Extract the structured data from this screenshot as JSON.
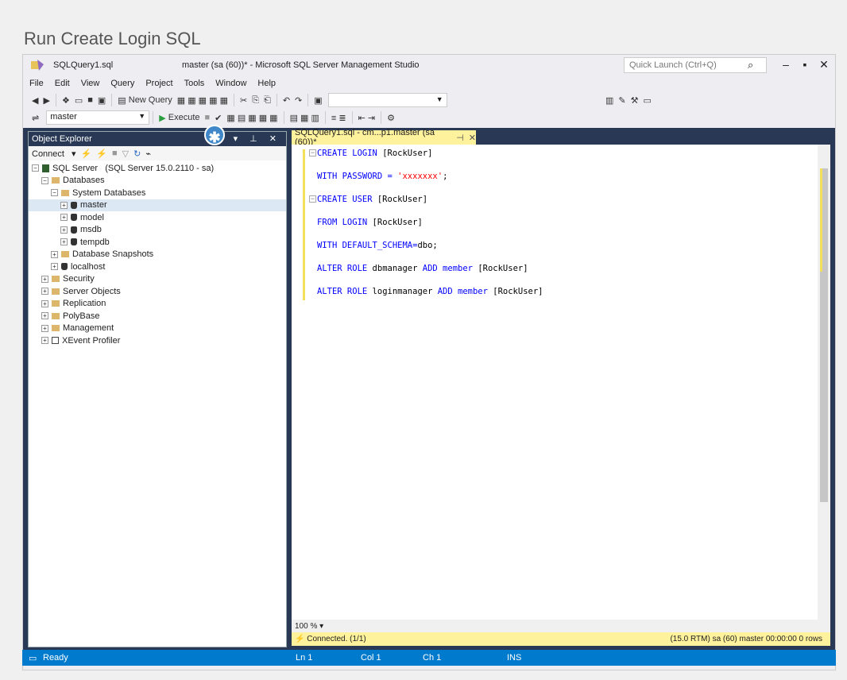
{
  "page_title": "Run Create Login SQL",
  "window": {
    "file_name": "SQLQuery1.sql",
    "title": "master (sa (60))* - Microsoft SQL Server Management Studio",
    "quick_launch_placeholder": "Quick Launch (Ctrl+Q)"
  },
  "menu": [
    "File",
    "Edit",
    "View",
    "Query",
    "Project",
    "Tools",
    "Window",
    "Help"
  ],
  "toolbar": {
    "new_query_label": "New Query",
    "database_selected": "master",
    "execute_label": "Execute"
  },
  "object_explorer": {
    "title": "Object Explorer",
    "connect_label": "Connect",
    "tree": [
      {
        "label": "SQL Server",
        "detail": "(SQL Server 15.0.2110 - sa)",
        "indent": 0,
        "icon": "server-icon",
        "expander": "−"
      },
      {
        "label": "Databases",
        "indent": 1,
        "icon": "folder-icon",
        "expander": "−"
      },
      {
        "label": "System Databases",
        "indent": 2,
        "icon": "folder-icon",
        "expander": "−"
      },
      {
        "label": "master",
        "indent": 3,
        "icon": "database-icon",
        "expander": "+",
        "highlight": true
      },
      {
        "label": "model",
        "indent": 3,
        "icon": "database-icon",
        "expander": "+"
      },
      {
        "label": "msdb",
        "indent": 3,
        "icon": "database-icon",
        "expander": "+"
      },
      {
        "label": "tempdb",
        "indent": 3,
        "icon": "database-icon",
        "expander": "+"
      },
      {
        "label": "Database Snapshots",
        "indent": 2,
        "icon": "folder-icon",
        "expander": "+"
      },
      {
        "label": "localhost",
        "indent": 2,
        "icon": "database-icon",
        "expander": "+"
      },
      {
        "label": "Security",
        "indent": 1,
        "icon": "folder-icon",
        "expander": "+"
      },
      {
        "label": "Server Objects",
        "indent": 1,
        "icon": "folder-icon",
        "expander": "+"
      },
      {
        "label": "Replication",
        "indent": 1,
        "icon": "folder-icon",
        "expander": "+"
      },
      {
        "label": "PolyBase",
        "indent": 1,
        "icon": "folder-icon",
        "expander": "+"
      },
      {
        "label": "Management",
        "indent": 1,
        "icon": "folder-icon",
        "expander": "+"
      },
      {
        "label": "XEvent Profiler",
        "indent": 1,
        "icon": "xevent-icon",
        "expander": "+"
      }
    ]
  },
  "badge_symbol": "✱",
  "editor": {
    "tab_label": "SQLQuery1.sql - cm...p1.master (sa (60))*",
    "lines": [
      {
        "kw": "CREATE LOGIN ",
        "rest": "[RockUser]",
        "fold": true
      },
      {
        "kw": "WITH PASSWORD = ",
        "str": "'xxxxxxx'",
        "rest": ";"
      },
      {
        "kw": "CREATE USER ",
        "rest": "[RockUser]",
        "fold": true
      },
      {
        "kw": "FROM LOGIN ",
        "rest": "[RockUser]"
      },
      {
        "kw": "WITH DEFAULT_SCHEMA=",
        "rest": "dbo;"
      },
      {
        "kw": "ALTER ROLE ",
        "rest": "dbmanager",
        "kw2": " ADD member ",
        "rest2": "[RockUser]"
      },
      {
        "kw": "ALTER ROLE ",
        "rest": "loginmanager",
        "kw2": " ADD member ",
        "rest2": "[RockUser]"
      }
    ],
    "zoom": "100 %",
    "connection_status": "Connected. (1/1)",
    "connection_details": "(15.0 RTM)  sa (60)  master  00:00:00  0 rows"
  },
  "status_bar": {
    "ready": "Ready",
    "ln": "Ln 1",
    "col": "Col 1",
    "ch": "Ch 1",
    "mode": "INS"
  }
}
